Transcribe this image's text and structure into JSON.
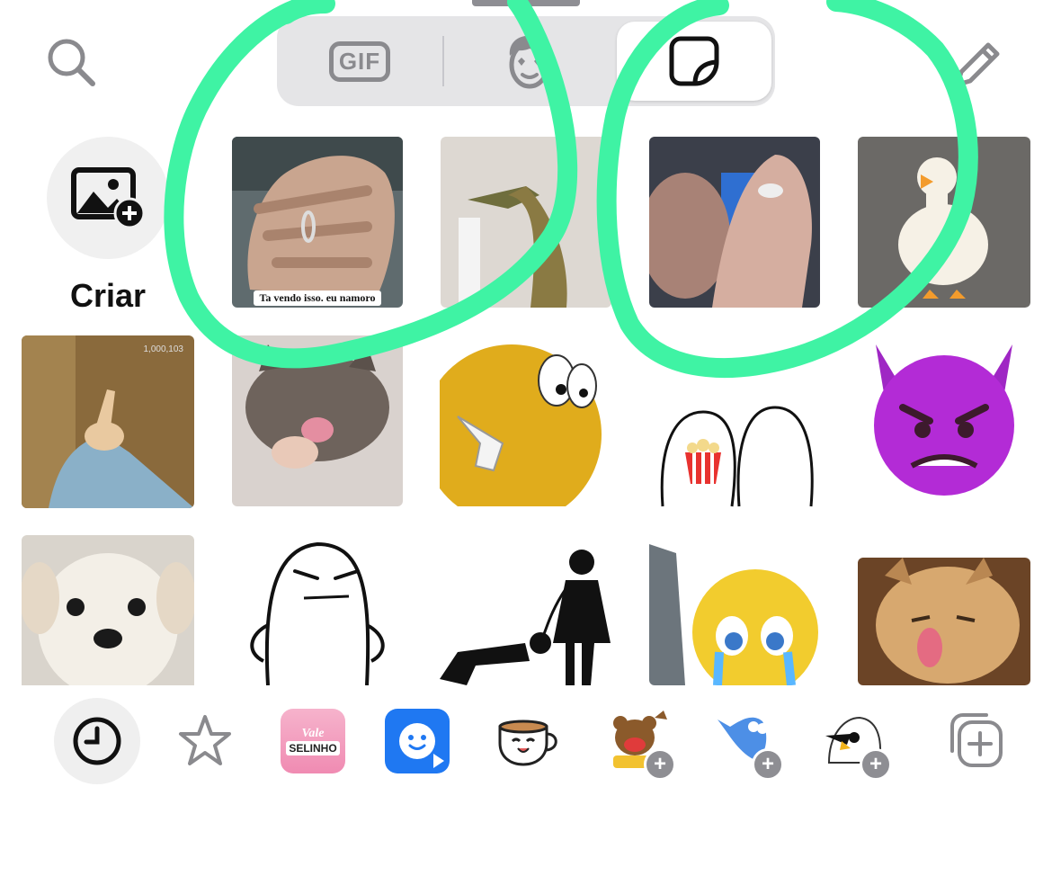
{
  "header": {
    "search_icon": "search-icon",
    "tabs": [
      {
        "id": "gif",
        "label": "GIF",
        "icon": "gif-icon",
        "selected": false
      },
      {
        "id": "memoji",
        "label": "",
        "icon": "memoji-face-icon",
        "selected": false
      },
      {
        "id": "stickers",
        "label": "",
        "icon": "sticker-icon",
        "selected": true
      }
    ],
    "edit_icon": "pencil-icon"
  },
  "create": {
    "label": "Criar",
    "icon": "add-photo-icon"
  },
  "stickers": [
    {
      "name": "hand-ring-selfie",
      "caption": "Ta vendo isso. eu namoro"
    },
    {
      "name": "crocodile",
      "caption": ""
    },
    {
      "name": "blurry-hand-ring",
      "caption": ""
    },
    {
      "name": "white-duck",
      "caption": ""
    },
    {
      "name": "cartoon-pointing-up",
      "caption": "",
      "counter": "1,000,103"
    },
    {
      "name": "cat-thumbs-up",
      "caption": ""
    },
    {
      "name": "yellow-blob-shrug",
      "caption": ""
    },
    {
      "name": "flork-popcorn-duo",
      "caption": ""
    },
    {
      "name": "purple-devil-emoji",
      "caption": ""
    },
    {
      "name": "white-puppy",
      "caption": ""
    },
    {
      "name": "flork-skeptical",
      "caption": ""
    },
    {
      "name": "pictogram-leash",
      "caption": ""
    },
    {
      "name": "crying-emoji-monitor",
      "caption": ""
    },
    {
      "name": "sleepy-dog-tongue",
      "caption": ""
    }
  ],
  "tray": [
    {
      "name": "recent",
      "icon": "clock-icon",
      "selected": true
    },
    {
      "name": "favorites",
      "icon": "star-icon",
      "selected": false
    },
    {
      "name": "vale-selinho-pack",
      "icon": "vale-selinho-pack-icon",
      "text_top": "Vale",
      "text_bottom": "SELINHO",
      "selected": false
    },
    {
      "name": "blue-face-app",
      "icon": "blue-smile-app-icon",
      "selected": false
    },
    {
      "name": "teacup-pack",
      "icon": "teacup-icon",
      "selected": false
    },
    {
      "name": "bear-pack",
      "icon": "bear-icon",
      "add_badge": "+",
      "selected": false
    },
    {
      "name": "blue-bird-pack",
      "icon": "blue-bird-icon",
      "add_badge": "+",
      "selected": false
    },
    {
      "name": "white-bird-pack",
      "icon": "white-bird-icon",
      "add_badge": "+",
      "selected": false
    },
    {
      "name": "add-pack",
      "icon": "add-sticker-pack-icon",
      "selected": false
    }
  ],
  "colors": {
    "highlight": "#3ff3a4",
    "segment_bg": "#e5e5e7",
    "icon_gray": "#8a8a8e",
    "devil_purple": "#b32bd6"
  }
}
